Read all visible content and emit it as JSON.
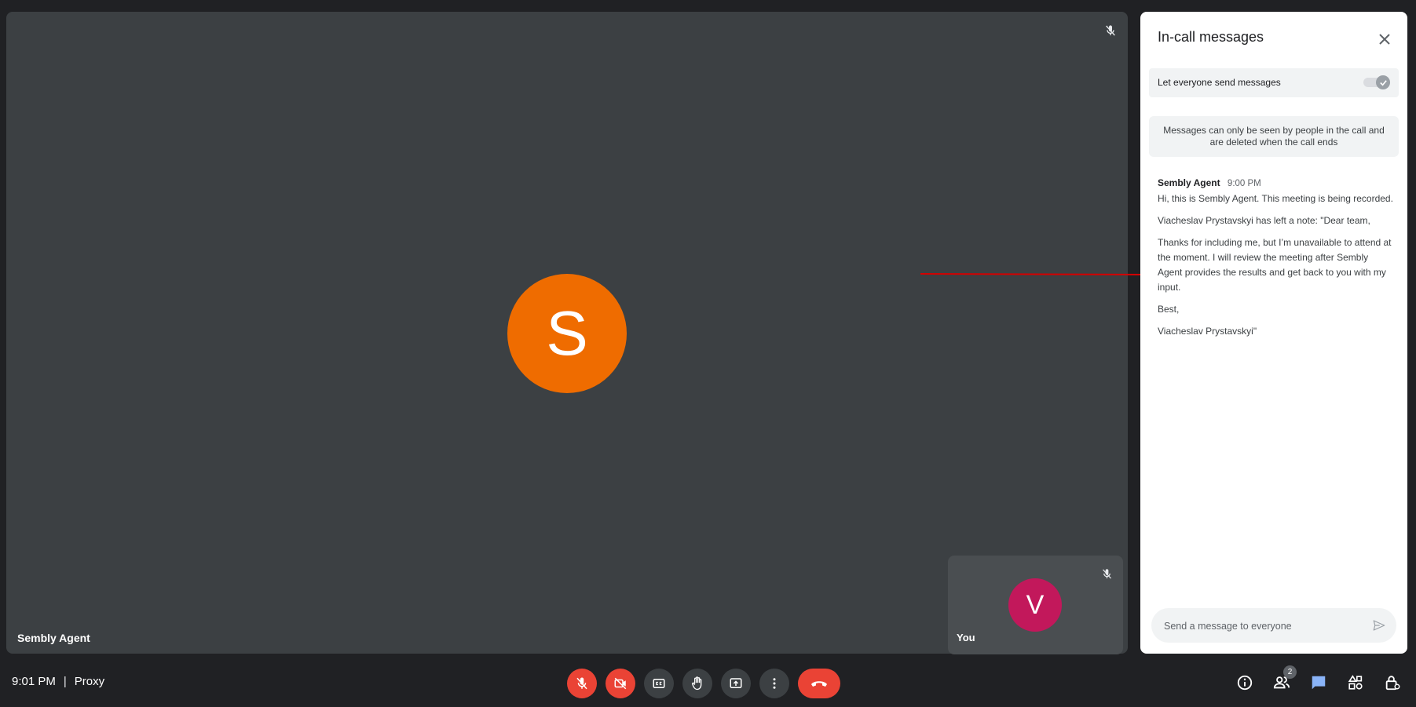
{
  "stage": {
    "participant_initial": "S",
    "participant_name": "Sembly Agent",
    "avatar_color": "#ef6c00"
  },
  "self_tile": {
    "initial": "V",
    "label": "You",
    "avatar_color": "#c2185b"
  },
  "chat_panel": {
    "title": "In-call messages",
    "toggle_label": "Let everyone send messages",
    "toggle_on": true,
    "info_text": "Messages can only be seen by people in the call and are deleted when the call ends",
    "messages": [
      {
        "sender": "Sembly Agent",
        "time": "9:00 PM",
        "paragraphs": [
          "Hi, this is Sembly Agent. This meeting is being recorded.",
          "Viacheslav Prystavskyi has left a note: \"Dear team,",
          "Thanks for including me, but I’m unavailable to attend at the moment. I will review the meeting after Sembly Agent provides the results and get back to you with my input.",
          "Best,",
          "Viacheslav Prystavskyi\""
        ]
      }
    ],
    "compose_placeholder": "Send a message to everyone"
  },
  "bottom_bar": {
    "time": "9:01 PM",
    "separator": "|",
    "meeting_name": "Proxy",
    "controls": [
      {
        "name": "mic-off-button",
        "icon": "mic-off-icon",
        "state": "off"
      },
      {
        "name": "camera-off-button",
        "icon": "camera-off-icon",
        "state": "off"
      },
      {
        "name": "captions-button",
        "icon": "captions-icon"
      },
      {
        "name": "raise-hand-button",
        "icon": "hand-icon"
      },
      {
        "name": "present-button",
        "icon": "present-screen-icon"
      },
      {
        "name": "more-options-button",
        "icon": "more-vert-icon"
      },
      {
        "name": "leave-call-button",
        "icon": "call-end-icon"
      }
    ],
    "right_icons": [
      {
        "name": "meeting-details-button",
        "icon": "info-icon"
      },
      {
        "name": "people-button",
        "icon": "people-icon",
        "badge": "2"
      },
      {
        "name": "chat-button",
        "icon": "chat-icon",
        "active": true
      },
      {
        "name": "activities-button",
        "icon": "activities-icon"
      },
      {
        "name": "host-controls-button",
        "icon": "lock-person-icon"
      }
    ]
  },
  "colors": {
    "background": "#202124",
    "tile": "#3c4043",
    "danger": "#ea4335",
    "active_blue": "#8ab4f8",
    "annotation_arrow": "#d50000"
  }
}
